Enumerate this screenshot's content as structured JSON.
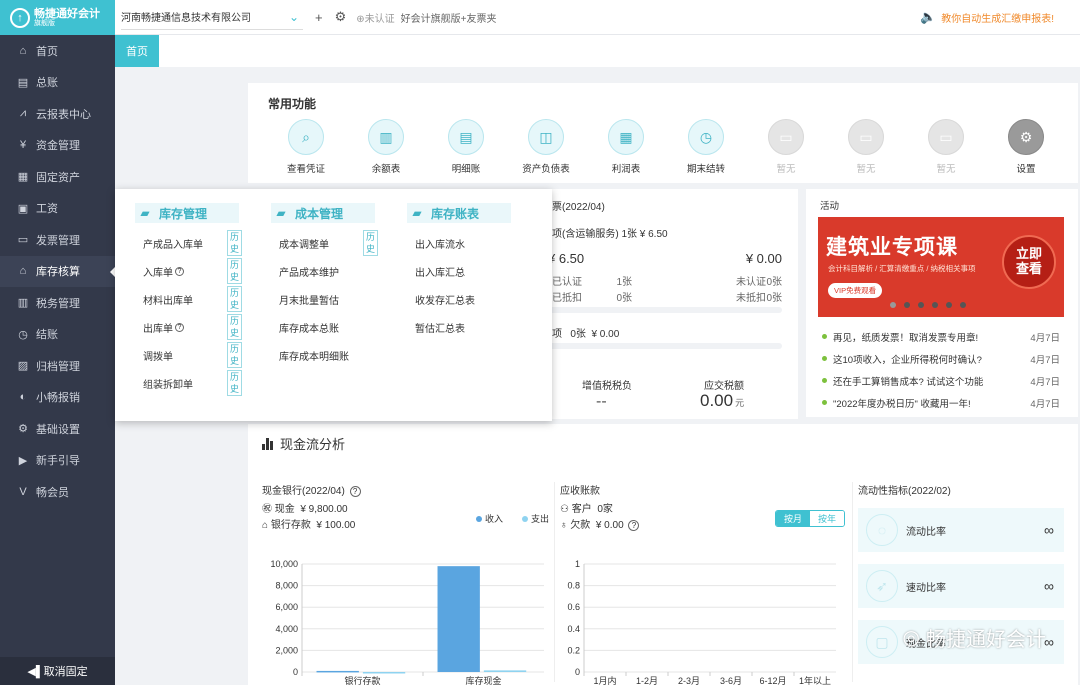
{
  "app": {
    "logo_name": "畅捷通好会计",
    "logo_sub": "旗舰版"
  },
  "sidebar": {
    "items": [
      {
        "label": "首页",
        "icon": "home-icon",
        "glyph": "⌂"
      },
      {
        "label": "总账",
        "icon": "ledger-icon",
        "glyph": "▤"
      },
      {
        "label": "云报表中心",
        "icon": "report-chart-icon",
        "glyph": "⩘"
      },
      {
        "label": "资金管理",
        "icon": "money-icon",
        "glyph": "¥"
      },
      {
        "label": "固定资产",
        "icon": "asset-icon",
        "glyph": "▦"
      },
      {
        "label": "工资",
        "icon": "salary-icon",
        "glyph": "▣"
      },
      {
        "label": "发票管理",
        "icon": "invoice-icon",
        "glyph": "▭"
      },
      {
        "label": "库存核算",
        "icon": "warehouse-icon",
        "glyph": "⌂"
      },
      {
        "label": "税务管理",
        "icon": "tax-icon",
        "glyph": "▥"
      },
      {
        "label": "结账",
        "icon": "closing-icon",
        "glyph": "◷"
      },
      {
        "label": "归档管理",
        "icon": "archive-icon",
        "glyph": "▨"
      },
      {
        "label": "小畅报销",
        "icon": "reimburse-icon",
        "glyph": "◐"
      },
      {
        "label": "基础设置",
        "icon": "settings-icon",
        "glyph": "⚙"
      },
      {
        "label": "新手引导",
        "icon": "guide-icon",
        "glyph": "▶"
      },
      {
        "label": "畅会员",
        "icon": "vip-icon",
        "glyph": "V"
      }
    ],
    "active_index": 7,
    "unpin_label": "◀▌取消固定"
  },
  "topbar": {
    "company": "河南畅捷通信息技术有限公司",
    "auth": "未认证",
    "edition": "好会计旗舰版+友票夹",
    "notice": "教你自动生成汇缴申报表!"
  },
  "tabs": {
    "home": "首页"
  },
  "functions": {
    "title": "常用功能",
    "items": [
      {
        "label": "查看凭证",
        "icon": "voucher-view-icon",
        "state": "normal"
      },
      {
        "label": "余额表",
        "icon": "balance-sheet-icon",
        "state": "normal"
      },
      {
        "label": "明细账",
        "icon": "detail-ledger-icon",
        "state": "normal"
      },
      {
        "label": "资产负债表",
        "icon": "asset-liability-icon",
        "state": "normal"
      },
      {
        "label": "利润表",
        "icon": "profit-table-icon",
        "state": "normal"
      },
      {
        "label": "期末结转",
        "icon": "period-end-icon",
        "state": "normal"
      },
      {
        "label": "暂无",
        "icon": "empty-slot-icon",
        "state": "disabled"
      },
      {
        "label": "暂无",
        "icon": "empty-slot-icon",
        "state": "disabled"
      },
      {
        "label": "暂无",
        "icon": "empty-slot-icon",
        "state": "disabled"
      },
      {
        "label": "设置",
        "icon": "gear-icon",
        "state": "dark"
      }
    ]
  },
  "dropdown": {
    "history_label": "历史",
    "columns": [
      {
        "title": "库存管理",
        "rows": [
          {
            "label": "产成品入库单",
            "hist": true,
            "help": false
          },
          {
            "label": "入库单",
            "hist": true,
            "help": true
          },
          {
            "label": "材料出库单",
            "hist": true,
            "help": false
          },
          {
            "label": "出库单",
            "hist": true,
            "help": true
          },
          {
            "label": "调拨单",
            "hist": true,
            "help": false
          },
          {
            "label": "组装拆卸单",
            "hist": true,
            "help": false
          }
        ]
      },
      {
        "title": "成本管理",
        "rows": [
          {
            "label": "成本调整单",
            "hist": true,
            "help": false
          },
          {
            "label": "产品成本维护",
            "hist": false,
            "help": false
          },
          {
            "label": "月末批量暂估",
            "hist": false,
            "help": false
          },
          {
            "label": "库存成本总账",
            "hist": false,
            "help": false
          },
          {
            "label": "库存成本明细账",
            "hist": false,
            "help": false
          }
        ]
      },
      {
        "title": "库存账表",
        "rows": [
          {
            "label": "出入库流水",
            "hist": false,
            "help": false
          },
          {
            "label": "出入库汇总",
            "hist": false,
            "help": false
          },
          {
            "label": "收发存汇总表",
            "hist": false,
            "help": false
          },
          {
            "label": "暂估汇总表",
            "hist": false,
            "help": false
          }
        ]
      }
    ]
  },
  "invoice": {
    "title_fragment": "票(2022/04)",
    "line1": "项(含运输服务) 1张 ¥ 6.50",
    "left_amount": "¥ 6.50",
    "right_amount": "¥ 0.00",
    "row_a_label": "已认证",
    "row_a_val": "1张",
    "row_b_label": "已抵扣",
    "row_b_val": "0张",
    "row_c_label": "未认证",
    "row_c_val": "0张",
    "row_d_label": "未抵扣",
    "row_d_val": "0张",
    "line2_a": "项",
    "line2_b": "0张",
    "line2_c": "¥ 0.00",
    "vat_label": "增值税税负",
    "vat_value": "--",
    "tax_label": "应交税额",
    "tax_value": "0.00",
    "tax_unit": "元"
  },
  "activity": {
    "title": "活动",
    "banner_title": "建筑业专项课",
    "banner_sub": "会计科目解析 / 汇算清缴重点 / 纳税相关事项",
    "banner_vip": "VIP免费观看",
    "banner_cta1": "立即",
    "banner_cta2": "查看",
    "news": [
      {
        "text": "再见，纸质发票！取消发票专用章!",
        "date": "4月7日"
      },
      {
        "text": "这10项收入，企业所得税何时确认?",
        "date": "4月7日"
      },
      {
        "text": "还在手工算销售成本? 试试这个功能",
        "date": "4月7日"
      },
      {
        "text": "\"2022年度办税日历\" 收藏用一年!",
        "date": "4月7日"
      }
    ]
  },
  "cashflow": {
    "title": "现金流分析",
    "bank_title": "现金银行(2022/04)",
    "cash_label": "现金",
    "cash_value": "¥ 9,800.00",
    "deposit_label": "银行存款",
    "deposit_value": "¥ 100.00",
    "legend_in": "收入",
    "legend_out": "支出",
    "recv_title": "应收账款",
    "customer_label": "客户",
    "customer_value": "0家",
    "owed_label": "欠款",
    "owed_value": "¥ 0.00",
    "toggle_month": "按月",
    "toggle_year": "按年",
    "ratio_title": "流动性指标(2022/02)",
    "ratios": [
      {
        "label": "流动比率",
        "value": "∞",
        "icon": "flow-ratio-icon"
      },
      {
        "label": "速动比率",
        "value": "∞",
        "icon": "rocket-icon"
      },
      {
        "label": "现金比率",
        "value": "∞",
        "icon": "cash-ratio-icon"
      }
    ],
    "colors": {
      "income": "#5aa5e0",
      "expense": "#8fd3f0"
    }
  },
  "watermark": "畅捷通好会计",
  "chart_data": [
    {
      "type": "bar",
      "categories": [
        "银行存款",
        "库存现金"
      ],
      "series": [
        {
          "name": "收入",
          "values": [
            100,
            9800
          ]
        },
        {
          "name": "支出",
          "values": [
            0,
            150
          ]
        }
      ],
      "yticks": [
        "0",
        "2,000",
        "4,000",
        "6,000",
        "8,000",
        "10,000"
      ],
      "ylim": [
        0,
        10000
      ]
    },
    {
      "type": "bar",
      "categories": [
        "1月内",
        "1-2月",
        "2-3月",
        "3-6月",
        "6-12月",
        "1年以上"
      ],
      "values": [
        0,
        0,
        0,
        0,
        0,
        0
      ],
      "yticks": [
        "0",
        "0.2",
        "0.4",
        "0.6",
        "0.8",
        "1"
      ],
      "ylim": [
        0,
        1
      ]
    }
  ]
}
